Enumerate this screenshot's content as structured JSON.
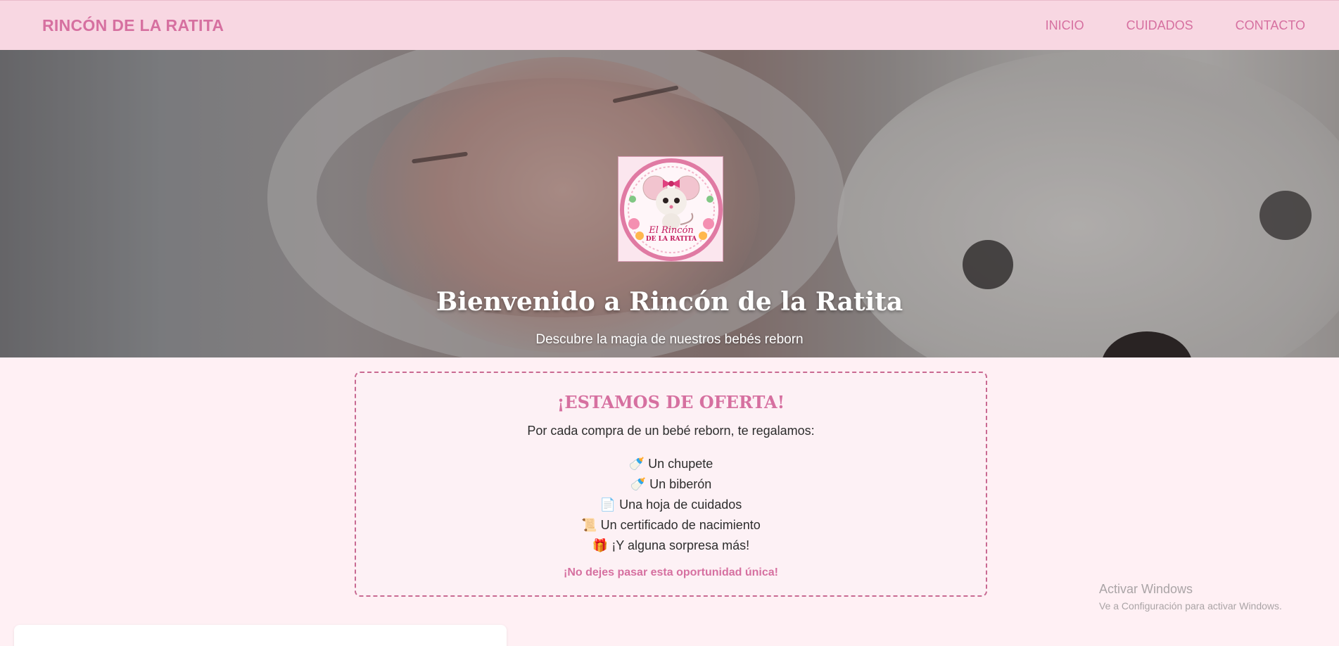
{
  "nav": {
    "brand": "RINCÓN DE LA RATITA",
    "links": [
      "INICIO",
      "CUIDADOS",
      "CONTACTO"
    ]
  },
  "hero": {
    "logo_text": [
      "El Rincón",
      "DE LA RATITA"
    ],
    "title": "Bienvenido a Rincón de la Ratita",
    "subtitle": "Descubre la magia de nuestros bebés reborn"
  },
  "offer": {
    "title": "¡ESTAMOS DE OFERTA!",
    "intro": "Por cada compra de un bebé reborn, te regalamos:",
    "items": [
      {
        "icon": "🍼",
        "icon_name": "bottle-icon",
        "text": "Un chupete"
      },
      {
        "icon": "🍼",
        "icon_name": "bottle-icon",
        "text": "Un biberón"
      },
      {
        "icon": "📄",
        "icon_name": "document-icon",
        "text": "Una hoja de cuidados"
      },
      {
        "icon": "📜",
        "icon_name": "scroll-icon",
        "text": "Un certificado de nacimiento"
      },
      {
        "icon": "🎁",
        "icon_name": "gift-icon",
        "text": "¡Y alguna sorpresa más!"
      }
    ],
    "cta": "¡No dejes pasar esta oportunidad única!"
  },
  "watermark": {
    "title": "Activar Windows",
    "subtitle": "Ve a Configuración para activar Windows."
  },
  "colors": {
    "brand_pink": "#d670a0",
    "navbar_bg": "#f8d7e2",
    "page_bg": "#fff0f4"
  }
}
